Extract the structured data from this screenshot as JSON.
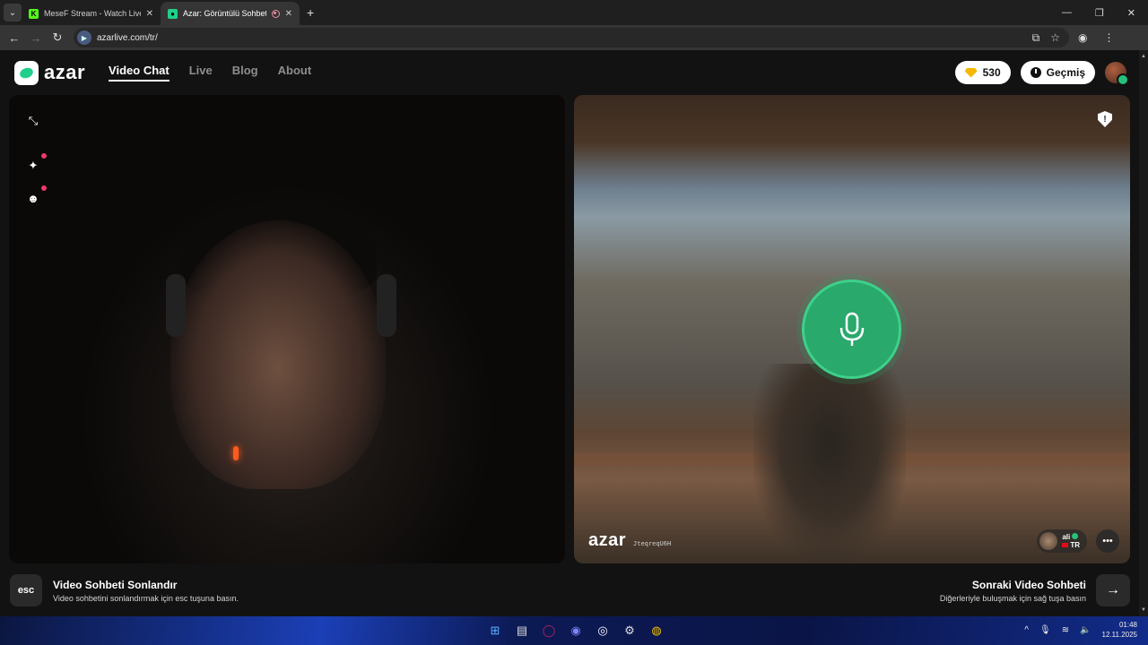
{
  "browser": {
    "tabs": [
      {
        "title": "MeseF Stream - Watch Live on Kick",
        "favicon": "kick-icon",
        "active": false
      },
      {
        "title": "Azar: Görüntülü Sohbet, Yeni",
        "favicon": "azar-icon",
        "active": true
      }
    ],
    "new_tab": "+",
    "url": "azarlive.com/tr/"
  },
  "site": {
    "logo_text": "azar",
    "nav": [
      {
        "label": "Video Chat",
        "active": true
      },
      {
        "label": "Live",
        "active": false
      },
      {
        "label": "Blog",
        "active": false
      },
      {
        "label": "About",
        "active": false
      }
    ],
    "gems": "530",
    "history_label": "Geçmiş"
  },
  "remote_video": {
    "watermark_logo": "azar",
    "watermark_id": "JteqreqU6H",
    "peer_name": "ali",
    "peer_country": "TR"
  },
  "footer": {
    "esc_label": "esc",
    "end_title": "Video Sohbeti Sonlandır",
    "end_sub": "Video sohbetini sonlandırmak için esc tuşuna basın.",
    "next_title": "Sonraki Video Sohbeti",
    "next_sub": "Diğerleriyle buluşmak için sağ tuşa basın"
  },
  "taskbar": {
    "time": "01:48",
    "date": "12.11.2025"
  },
  "colors": {
    "accent": "#29a96c",
    "page_bg": "#121212",
    "gem": "#f5b800"
  }
}
